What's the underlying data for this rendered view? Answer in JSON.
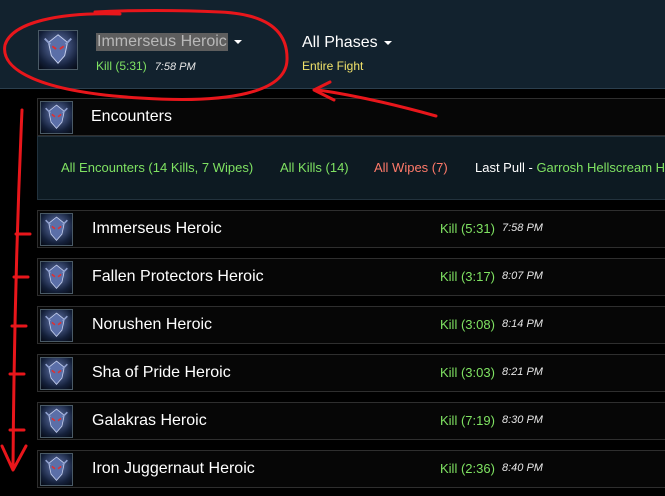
{
  "header": {
    "fight_name": "Immerseus Heroic",
    "fight_result": "Kill (5:31)",
    "fight_time": "7:58 PM",
    "phase": "All Phases",
    "phase_sub": "Entire Fight"
  },
  "encounters": {
    "title": "Encounters",
    "filters": {
      "all": "All Encounters (14 Kills, 7 Wipes)",
      "kills": "All Kills (14)",
      "wipes": "All Wipes (7)",
      "last_pull_label": "Last Pull",
      "last_pull_sep": " - ",
      "last_pull_boss": "Garrosh Hellscream H"
    },
    "rows": [
      {
        "name": "Immerseus Heroic",
        "result": "Kill (5:31)",
        "time": "7:58 PM"
      },
      {
        "name": "Fallen Protectors Heroic",
        "result": "Kill (3:17)",
        "time": "8:07 PM"
      },
      {
        "name": "Norushen Heroic",
        "result": "Kill (3:08)",
        "time": "8:14 PM"
      },
      {
        "name": "Sha of Pride Heroic",
        "result": "Kill (3:03)",
        "time": "8:21 PM"
      },
      {
        "name": "Galakras Heroic",
        "result": "Kill (7:19)",
        "time": "8:30 PM"
      },
      {
        "name": "Iron Juggernaut Heroic",
        "result": "Kill (2:36)",
        "time": "8:40 PM"
      }
    ]
  },
  "icons": {
    "boss": "boss-portrait-icon",
    "dropdown": "chevron-down-icon"
  },
  "colors": {
    "kill": "#7fe262",
    "wipe": "#ff7a6a",
    "phase_sub": "#f1e26a",
    "annotation": "#e8161b"
  }
}
